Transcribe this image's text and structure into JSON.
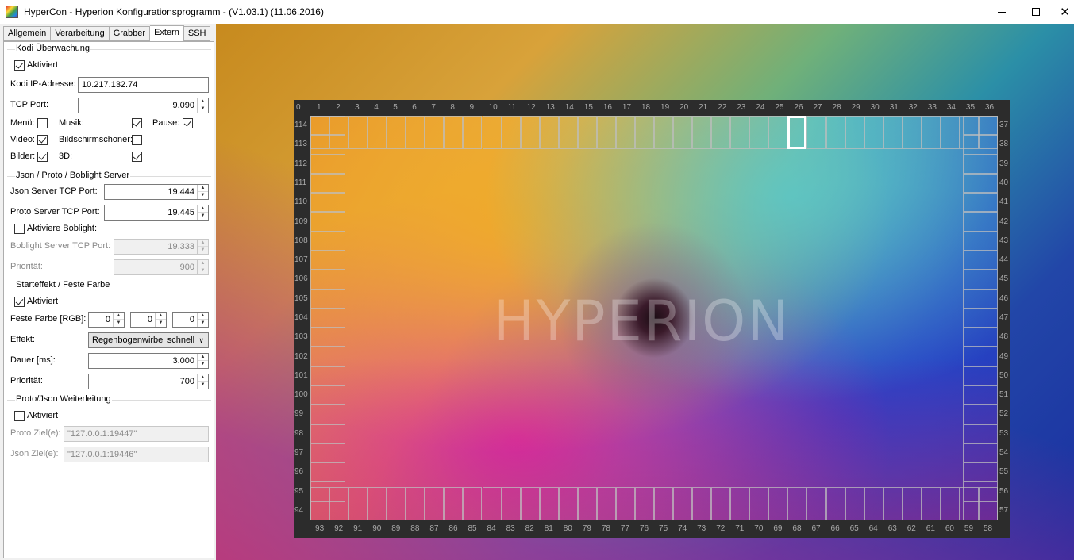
{
  "window": {
    "title": "HyperCon - Hyperion Konfigurationsprogramm - (V1.03.1) (11.06.2016)",
    "controls": [
      "minimize-icon",
      "maximize-icon",
      "close-icon"
    ],
    "close_glyph": "✕"
  },
  "tabs": [
    {
      "label": "Allgemein",
      "active": false
    },
    {
      "label": "Verarbeitung",
      "active": false
    },
    {
      "label": "Grabber",
      "active": false
    },
    {
      "label": "Extern",
      "active": true
    },
    {
      "label": "SSH",
      "active": false
    }
  ],
  "kodi": {
    "title": "Kodi Überwachung",
    "activated_label": "Aktiviert",
    "activated": true,
    "ip_label": "Kodi IP-Adresse:",
    "ip_value": "10.217.132.74",
    "port_label": "TCP Port:",
    "port_value": "9.090",
    "menu_label": "Menü:",
    "menu": false,
    "music_label": "Musik:",
    "music": true,
    "pause_label": "Pause:",
    "pause": true,
    "video_label": "Video:",
    "video": true,
    "screensaver_label": "Bildschirmschoner:",
    "screensaver": false,
    "pictures_label": "Bilder:",
    "pictures": true,
    "threed_label": "3D:",
    "threed": true
  },
  "servers": {
    "title": "Json / Proto / Boblight Server",
    "json_label": "Json Server TCP Port:",
    "json_value": "19.444",
    "proto_label": "Proto Server TCP Port:",
    "proto_value": "19.445",
    "boblight_enable_label": "Aktiviere Boblight:",
    "boblight_enabled": false,
    "boblight_port_label": "Boblight Server TCP Port:",
    "boblight_port_value": "19.333",
    "priority_label": "Priorität:",
    "priority_value": "900"
  },
  "startup": {
    "title": "Starteffekt / Feste Farbe",
    "activated_label": "Aktiviert",
    "activated": true,
    "color_label": "Feste Farbe [RGB]:",
    "r": "0",
    "g": "0",
    "b": "0",
    "effect_label": "Effekt:",
    "effect_value": "Regenbogenwirbel schnell",
    "duration_label": "Dauer [ms]:",
    "duration_value": "3.000",
    "priority_label": "Priorität:",
    "priority_value": "700"
  },
  "forward": {
    "title": "Proto/Json Weiterleitung",
    "activated_label": "Aktiviert",
    "activated": false,
    "proto_label": "Proto Ziel(e):",
    "proto_value": "\"127.0.0.1:19447\"",
    "json_label": "Json Ziel(e):",
    "json_value": "\"127.0.0.1:19446\""
  },
  "preview": {
    "watermark": "HYPERION",
    "top_numbers": [
      "0",
      "1",
      "2",
      "3",
      "4",
      "5",
      "6",
      "7",
      "8",
      "9",
      "10",
      "11",
      "12",
      "13",
      "14",
      "15",
      "16",
      "17",
      "18",
      "19",
      "20",
      "21",
      "22",
      "23",
      "24",
      "25",
      "26",
      "27",
      "28",
      "29",
      "30",
      "31",
      "32",
      "33",
      "34",
      "35",
      "36"
    ],
    "right_numbers": [
      "37",
      "38",
      "39",
      "40",
      "41",
      "42",
      "43",
      "44",
      "45",
      "46",
      "47",
      "48",
      "49",
      "50",
      "51",
      "52",
      "53",
      "54",
      "55",
      "56",
      "57"
    ],
    "bottom_numbers": [
      "93",
      "92",
      "91",
      "90",
      "89",
      "88",
      "87",
      "86",
      "85",
      "84",
      "83",
      "82",
      "81",
      "80",
      "79",
      "78",
      "77",
      "76",
      "75",
      "74",
      "73",
      "72",
      "71",
      "70",
      "69",
      "68",
      "67",
      "66",
      "65",
      "64",
      "63",
      "62",
      "61",
      "60",
      "59",
      "58"
    ],
    "left_numbers": [
      "114",
      "113",
      "112",
      "111",
      "110",
      "109",
      "108",
      "107",
      "106",
      "105",
      "104",
      "103",
      "102",
      "101",
      "100",
      "99",
      "98",
      "97",
      "96",
      "95",
      "94"
    ],
    "selected_led": "26"
  }
}
